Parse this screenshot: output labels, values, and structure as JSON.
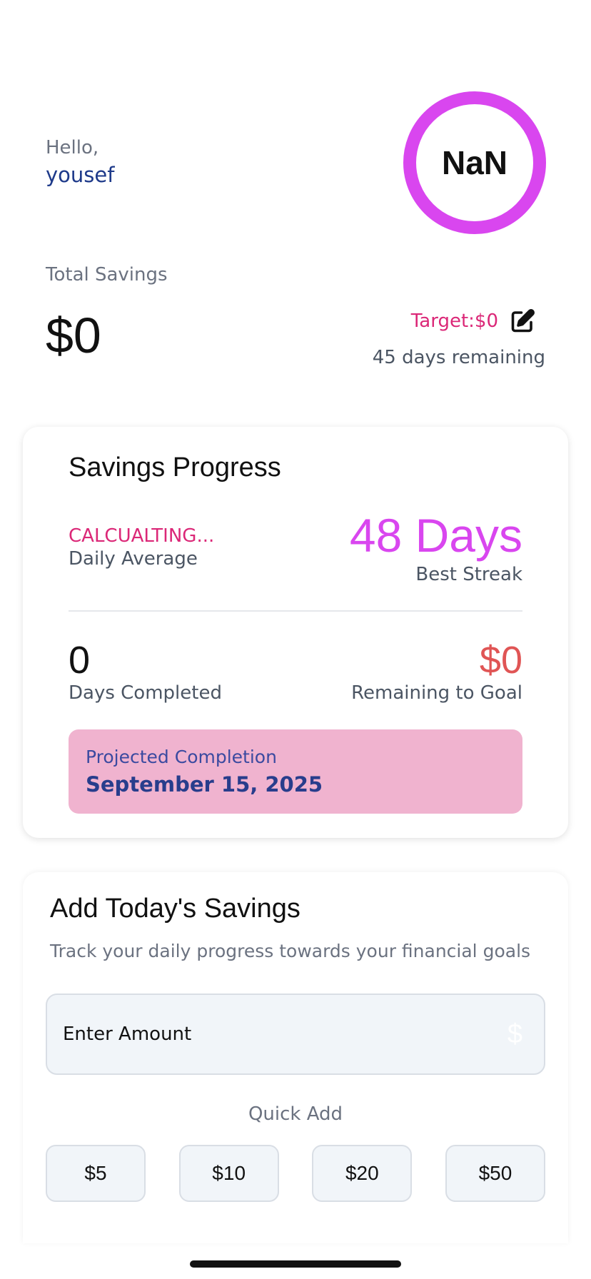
{
  "header": {
    "greeting": "Hello,",
    "user_name": "yousef",
    "ring_value": "NaN",
    "ring_color": "#d946ef"
  },
  "summary": {
    "total_label": "Total Savings",
    "total_value": "$0",
    "target_text": "Target:$0",
    "edit_icon": "edit-icon",
    "days_remaining": "45 days remaining"
  },
  "progress": {
    "title": "Savings Progress",
    "daily_average_value": "CALCUALTING...",
    "daily_average_label": "Daily Average",
    "best_streak_value": "48 Days",
    "best_streak_label": "Best Streak",
    "days_completed_value": "0",
    "days_completed_label": "Days Completed",
    "remaining_value": "$0",
    "remaining_label": "Remaining to Goal",
    "projection_label": "Projected Completion",
    "projection_date": "September 15, 2025"
  },
  "add": {
    "title": "Add Today's Savings",
    "subtitle": "Track your daily progress towards your financial goals",
    "amount_placeholder": "Enter Amount",
    "amount_value": "",
    "currency_icon": "$",
    "quick_add_label": "Quick Add",
    "quick_buttons": [
      "$5",
      "$10",
      "$20",
      "$50"
    ]
  },
  "colors": {
    "accent_pink": "#db2777",
    "accent_magenta": "#d946ef",
    "navy": "#1e3a8a",
    "alert_red": "#e05555",
    "projection_bg": "#f0b3cf"
  }
}
